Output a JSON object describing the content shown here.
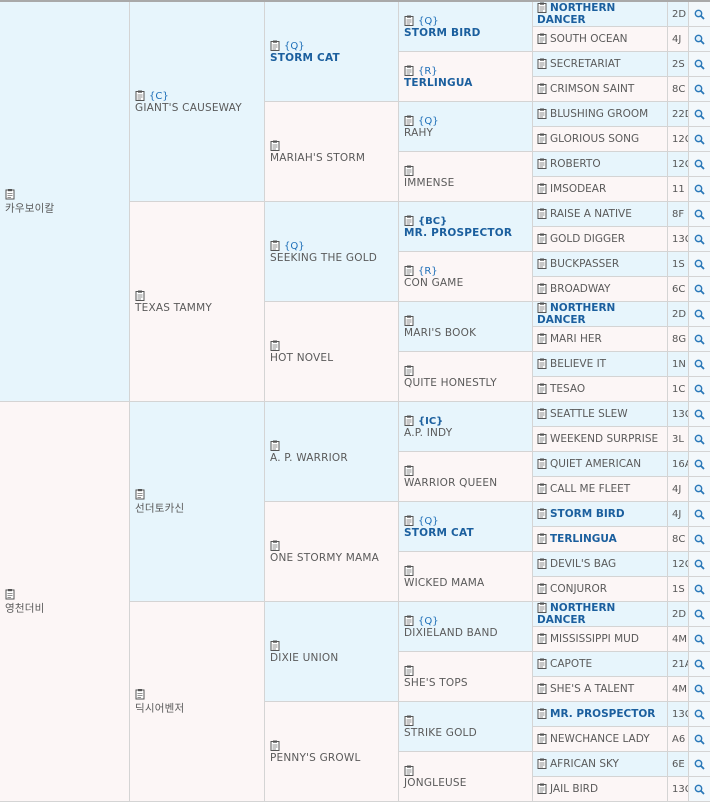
{
  "pedigree": {
    "g1": [
      {
        "name": "카우보이칼",
        "side": "sire"
      },
      {
        "name": "영천더비",
        "side": "dam"
      }
    ],
    "g2": [
      {
        "code": "{C}",
        "name": "GIANT'S CAUSEWAY",
        "side": "sire"
      },
      {
        "code": "",
        "name": "TEXAS TAMMY",
        "side": "dam"
      },
      {
        "code": "",
        "name": "선더토카신",
        "side": "sire"
      },
      {
        "code": "",
        "name": "딕시어벤저",
        "side": "dam"
      }
    ],
    "g3": [
      {
        "code": "{Q}",
        "name": "STORM CAT",
        "side": "sire",
        "bold": true
      },
      {
        "code": "",
        "name": "MARIAH'S STORM",
        "side": "dam"
      },
      {
        "code": "{Q}",
        "name": "SEEKING THE GOLD",
        "side": "sire"
      },
      {
        "code": "",
        "name": "HOT NOVEL",
        "side": "dam"
      },
      {
        "code": "",
        "name": "A. P. WARRIOR",
        "side": "sire"
      },
      {
        "code": "",
        "name": "ONE STORMY MAMA",
        "side": "dam"
      },
      {
        "code": "",
        "name": "DIXIE UNION",
        "side": "sire"
      },
      {
        "code": "",
        "name": "PENNY'S GROWL",
        "side": "dam"
      }
    ],
    "g4": [
      {
        "code": "{Q}",
        "name": "STORM BIRD",
        "side": "sire",
        "bold": true
      },
      {
        "code": "{R}",
        "name": "TERLINGUA",
        "side": "dam",
        "bold": true
      },
      {
        "code": "{Q}",
        "name": "RAHY",
        "side": "sire"
      },
      {
        "code": "",
        "name": "IMMENSE",
        "side": "dam"
      },
      {
        "code": "{BC}",
        "name": "MR. PROSPECTOR",
        "side": "sire",
        "bold": true,
        "codeBold": true
      },
      {
        "code": "{R}",
        "name": "CON GAME",
        "side": "dam"
      },
      {
        "code": "",
        "name": "MARI'S BOOK",
        "side": "sire"
      },
      {
        "code": "",
        "name": "QUITE HONESTLY",
        "side": "dam"
      },
      {
        "code": "{IC}",
        "name": "A.P. INDY",
        "side": "sire",
        "codeBold": true
      },
      {
        "code": "",
        "name": "WARRIOR QUEEN",
        "side": "dam"
      },
      {
        "code": "{Q}",
        "name": "STORM CAT",
        "side": "sire",
        "bold": true
      },
      {
        "code": "",
        "name": "WICKED MAMA",
        "side": "dam"
      },
      {
        "code": "{Q}",
        "name": "DIXIELAND BAND",
        "side": "sire"
      },
      {
        "code": "",
        "name": "SHE'S TOPS",
        "side": "dam"
      },
      {
        "code": "",
        "name": "STRIKE GOLD",
        "side": "sire"
      },
      {
        "code": "",
        "name": "JONGLEUSE",
        "side": "dam"
      }
    ],
    "g5": [
      {
        "name": "NORTHERN DANCER",
        "rating": "2D",
        "side": "sire",
        "bold": true
      },
      {
        "name": "SOUTH OCEAN",
        "rating": "4J",
        "side": "dam"
      },
      {
        "name": "SECRETARIAT",
        "rating": "2S",
        "side": "sire"
      },
      {
        "name": "CRIMSON SAINT",
        "rating": "8C",
        "side": "dam"
      },
      {
        "name": "BLUSHING GROOM",
        "rating": "22D",
        "side": "sire"
      },
      {
        "name": "GLORIOUS SONG",
        "rating": "12C",
        "side": "dam"
      },
      {
        "name": "ROBERTO",
        "rating": "12C",
        "side": "sire"
      },
      {
        "name": "IMSODEAR",
        "rating": "11",
        "side": "dam"
      },
      {
        "name": "RAISE A NATIVE",
        "rating": "8F",
        "side": "sire"
      },
      {
        "name": "GOLD DIGGER",
        "rating": "13C",
        "side": "dam"
      },
      {
        "name": "BUCKPASSER",
        "rating": "1S",
        "side": "sire"
      },
      {
        "name": "BROADWAY",
        "rating": "6C",
        "side": "dam"
      },
      {
        "name": "NORTHERN DANCER",
        "rating": "2D",
        "side": "sire",
        "bold": true
      },
      {
        "name": "MARI HER",
        "rating": "8G",
        "side": "dam"
      },
      {
        "name": "BELIEVE IT",
        "rating": "1N",
        "side": "sire"
      },
      {
        "name": "TESAO",
        "rating": "1C",
        "side": "dam"
      },
      {
        "name": "SEATTLE SLEW",
        "rating": "13C",
        "side": "sire"
      },
      {
        "name": "WEEKEND SURPRISE",
        "rating": "3L",
        "side": "dam"
      },
      {
        "name": "QUIET AMERICAN",
        "rating": "16A",
        "side": "sire"
      },
      {
        "name": "CALL ME FLEET",
        "rating": "4J",
        "side": "dam"
      },
      {
        "name": "STORM BIRD",
        "rating": "4J",
        "side": "sire",
        "bold": true
      },
      {
        "name": "TERLINGUA",
        "rating": "8C",
        "side": "dam",
        "bold": true
      },
      {
        "name": "DEVIL'S BAG",
        "rating": "12C",
        "side": "sire"
      },
      {
        "name": "CONJUROR",
        "rating": "1S",
        "side": "dam"
      },
      {
        "name": "NORTHERN DANCER",
        "rating": "2D",
        "side": "sire",
        "bold": true
      },
      {
        "name": "MISSISSIPPI MUD",
        "rating": "4M",
        "side": "dam"
      },
      {
        "name": "CAPOTE",
        "rating": "21A",
        "side": "sire"
      },
      {
        "name": "SHE'S A TALENT",
        "rating": "4M",
        "side": "dam"
      },
      {
        "name": "MR. PROSPECTOR",
        "rating": "13C",
        "side": "sire",
        "bold": true
      },
      {
        "name": "NEWCHANCE LADY",
        "rating": "A6",
        "side": "dam"
      },
      {
        "name": "AFRICAN SKY",
        "rating": "6E",
        "side": "sire"
      },
      {
        "name": "JAIL BIRD",
        "rating": "13C",
        "side": "dam"
      }
    ]
  },
  "icons": {
    "clipboard": "clipboard-icon",
    "search": "magnifier-icon"
  },
  "colors": {
    "sire_bg": "#e7f5fc",
    "dam_bg": "#fcf6f6",
    "link": "#1b5f9e"
  }
}
